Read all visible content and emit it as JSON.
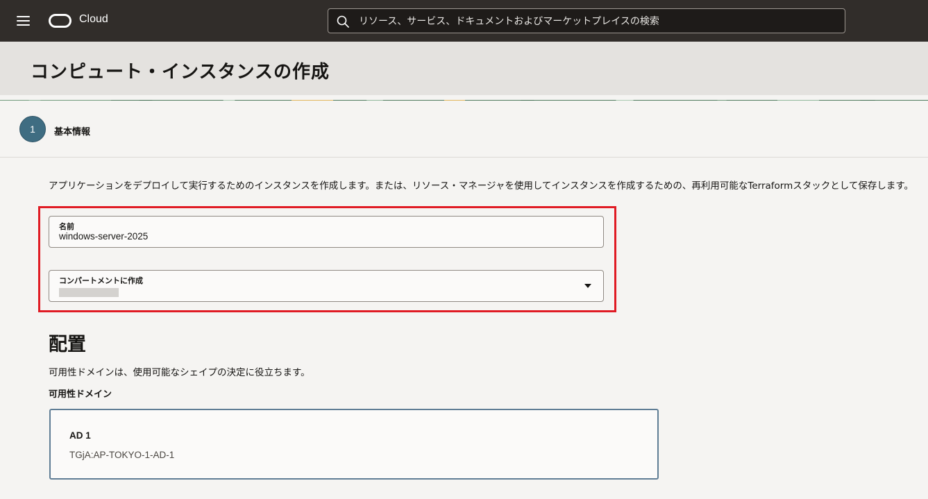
{
  "header": {
    "brand": "Cloud",
    "search_placeholder": "リソース、サービス、ドキュメントおよびマーケットプレイスの検索"
  },
  "page": {
    "title": "コンピュート・インスタンスの作成"
  },
  "step": {
    "number": "1",
    "label": "基本情報"
  },
  "description": "アプリケーションをデプロイして実行するためのインスタンスを作成します。または、リソース・マネージャを使用してインスタンスを作成するための、再利用可能なTerraformスタックとして保存します。",
  "form": {
    "name_label": "名前",
    "name_value": "windows-server-2025",
    "compartment_label": "コンパートメントに作成"
  },
  "placement": {
    "title": "配置",
    "description": "可用性ドメインは、使用可能なシェイプの決定に役立ちます。",
    "group_label": "可用性ドメイン",
    "options": [
      {
        "title": "AD 1",
        "subtitle": "TGjA:AP-TOKYO-1-AD-1"
      }
    ]
  },
  "colors": {
    "topbar": "#312d2a",
    "highlight": "#e01b24",
    "step": "#3f6d82",
    "selected_border": "#5f7d95"
  }
}
